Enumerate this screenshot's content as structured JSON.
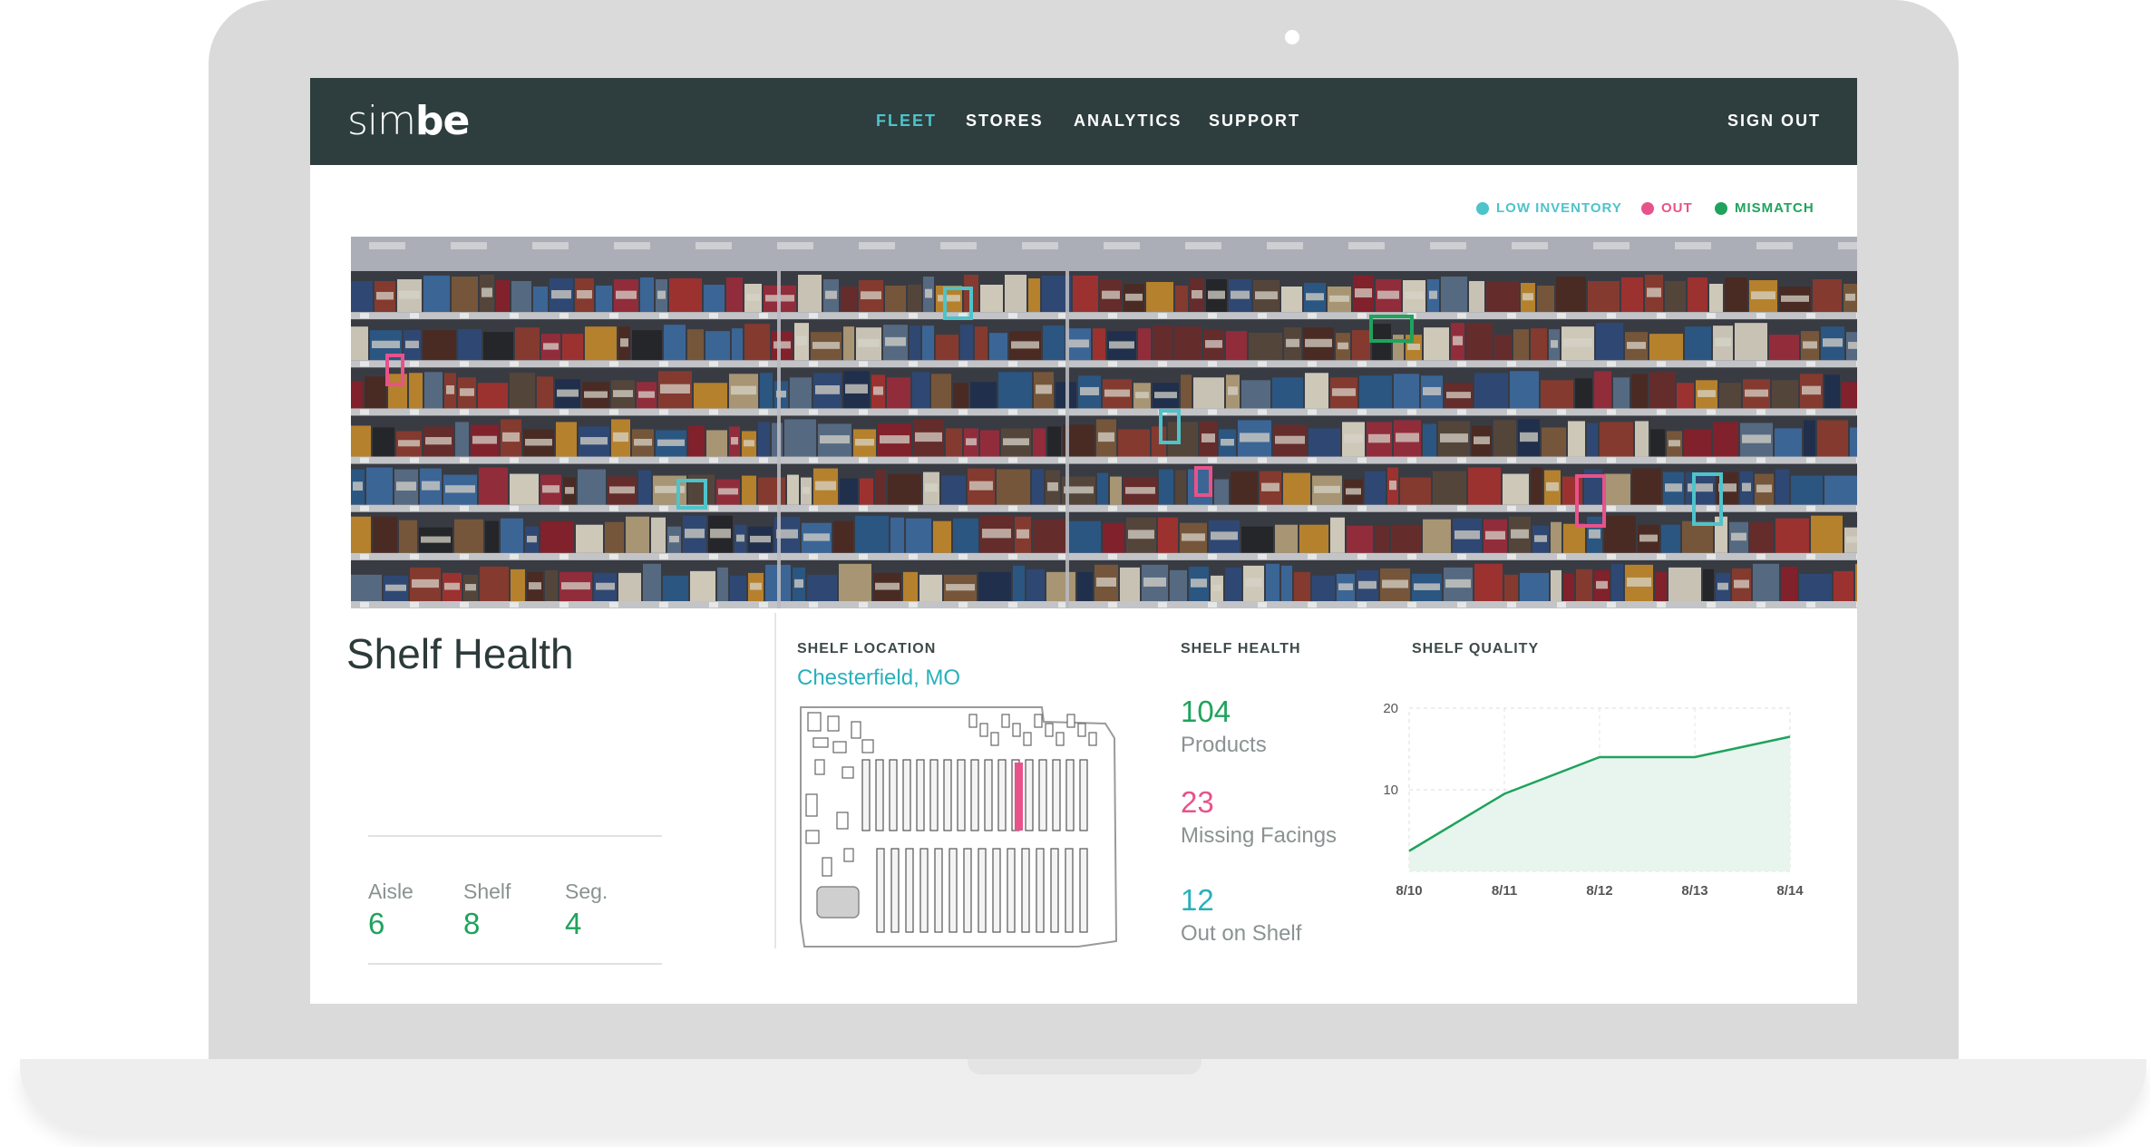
{
  "app": {
    "logo_light": "sim",
    "logo_bold": "be"
  },
  "nav": {
    "items": [
      {
        "label": "FLEET",
        "active": true
      },
      {
        "label": "STORES",
        "active": false
      },
      {
        "label": "ANALYTICS",
        "active": false
      },
      {
        "label": "SUPPORT",
        "active": false
      }
    ],
    "sign_out": "SIGN OUT"
  },
  "legend": [
    {
      "label": "LOW INVENTORY",
      "color": "#4ec3ca"
    },
    {
      "label": "OUT",
      "color": "#e8528a"
    },
    {
      "label": "MISMATCH",
      "color": "#1fa35c"
    }
  ],
  "page": {
    "title": "Shelf Health"
  },
  "position": {
    "aisle_label": "Aisle",
    "aisle": "6",
    "shelf_label": "Shelf",
    "shelf": "8",
    "seg_label": "Seg.",
    "seg": "4"
  },
  "location": {
    "label": "SHELF LOCATION",
    "value": "Chesterfield, MO"
  },
  "health": {
    "label": "SHELF HEALTH",
    "products": "104",
    "products_label": "Products",
    "missing": "23",
    "missing_label": "Missing Facings",
    "out": "12",
    "out_label": "Out on Shelf"
  },
  "quality": {
    "label": "SHELF QUALITY"
  },
  "colors": {
    "nav_bg": "#2e3d3d",
    "accent_teal": "#4ec3ca",
    "accent_pink": "#e8528a",
    "accent_green": "#1fa35c"
  },
  "chart_data": {
    "type": "area",
    "title": "SHELF QUALITY",
    "x": [
      "8/10",
      "8/11",
      "8/12",
      "8/13",
      "8/14"
    ],
    "values": [
      2.5,
      9.5,
      14,
      14,
      16.5
    ],
    "ylim": [
      0,
      20
    ],
    "yticks": [
      10,
      20
    ],
    "grid": true
  }
}
